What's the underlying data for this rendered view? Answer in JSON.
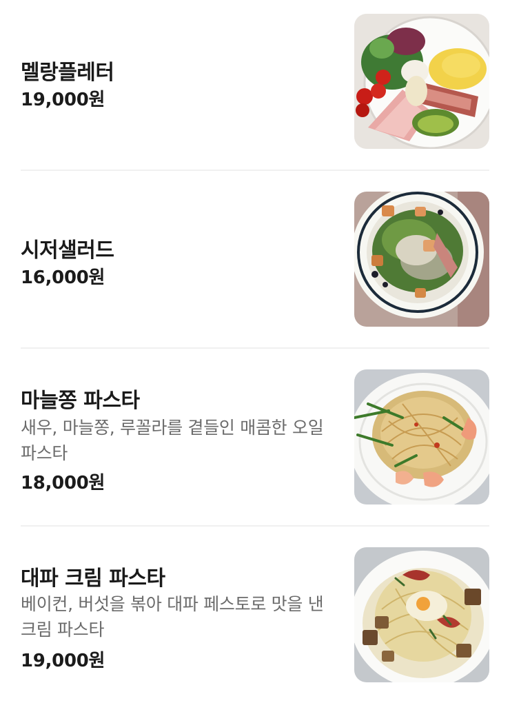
{
  "menu": {
    "items": [
      {
        "name": "멜랑플레터",
        "description": "",
        "price": "19,000원",
        "image": "brunch-plate-photo"
      },
      {
        "name": "시저샐러드",
        "description": "",
        "price": "16,000원",
        "image": "caesar-salad-photo"
      },
      {
        "name": "마늘쫑 파스타",
        "description": "새우, 마늘쫑, 루꼴라를 곁들인 매콤한 오일 파스타",
        "price": "18,000원",
        "image": "garlic-shrimp-pasta-photo"
      },
      {
        "name": "대파 크림 파스타",
        "description": "베이컨, 버섯을 볶아 대파 페스토로 맛을 낸 크림 파스타",
        "price": "19,000원",
        "image": "leek-cream-pasta-photo"
      }
    ]
  },
  "colors": {
    "text": "#1b1b1b",
    "description": "#6b6b6b",
    "divider": "#f0f0f0",
    "background": "#ffffff"
  }
}
